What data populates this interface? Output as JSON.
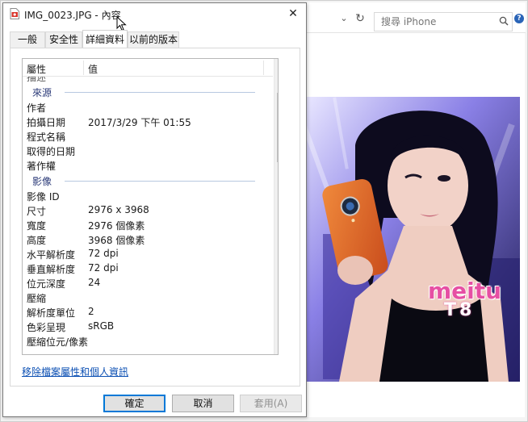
{
  "dialog": {
    "title": "IMG_0023.JPG - 內容",
    "close_glyph": "✕",
    "tabs": [
      {
        "label": "一般",
        "active": false
      },
      {
        "label": "安全性",
        "active": false
      },
      {
        "label": "詳細資料",
        "active": true
      },
      {
        "label": "以前的版本",
        "active": false
      }
    ],
    "columns": {
      "property": "屬性",
      "value": "值"
    },
    "groups": {
      "origin": {
        "label": "來源",
        "rows": [
          {
            "prop": "作者",
            "val": ""
          },
          {
            "prop": "拍攝日期",
            "val": "2017/3/29 下午 01:55"
          },
          {
            "prop": "程式名稱",
            "val": ""
          },
          {
            "prop": "取得的日期",
            "val": ""
          },
          {
            "prop": "著作權",
            "val": ""
          }
        ]
      },
      "image": {
        "label": "影像",
        "rows": [
          {
            "prop": "影像 ID",
            "val": ""
          },
          {
            "prop": "尺寸",
            "val": "2976 x 3968"
          },
          {
            "prop": "寬度",
            "val": "2976 個像素"
          },
          {
            "prop": "高度",
            "val": "3968 個像素"
          },
          {
            "prop": "水平解析度",
            "val": "72 dpi"
          },
          {
            "prop": "垂直解析度",
            "val": "72 dpi"
          },
          {
            "prop": "位元深度",
            "val": "24"
          },
          {
            "prop": "壓縮",
            "val": ""
          },
          {
            "prop": "解析度單位",
            "val": "2"
          },
          {
            "prop": "色彩呈現",
            "val": "sRGB"
          },
          {
            "prop": "壓縮位元/像素",
            "val": ""
          }
        ]
      }
    },
    "remove_link": "移除檔案屬性和個人資訊",
    "buttons": {
      "ok": "確定",
      "cancel": "取消",
      "apply": "套用(A)"
    }
  },
  "explorer": {
    "search_placeholder": "搜尋 iPhone"
  },
  "photo": {
    "brand_line1": "meitu",
    "brand_line2": "T8"
  },
  "colors": {
    "accent": "#0078d7",
    "group_label": "#2b3a78",
    "link": "#0b4fb3",
    "phone_orange": "#e8692c"
  }
}
